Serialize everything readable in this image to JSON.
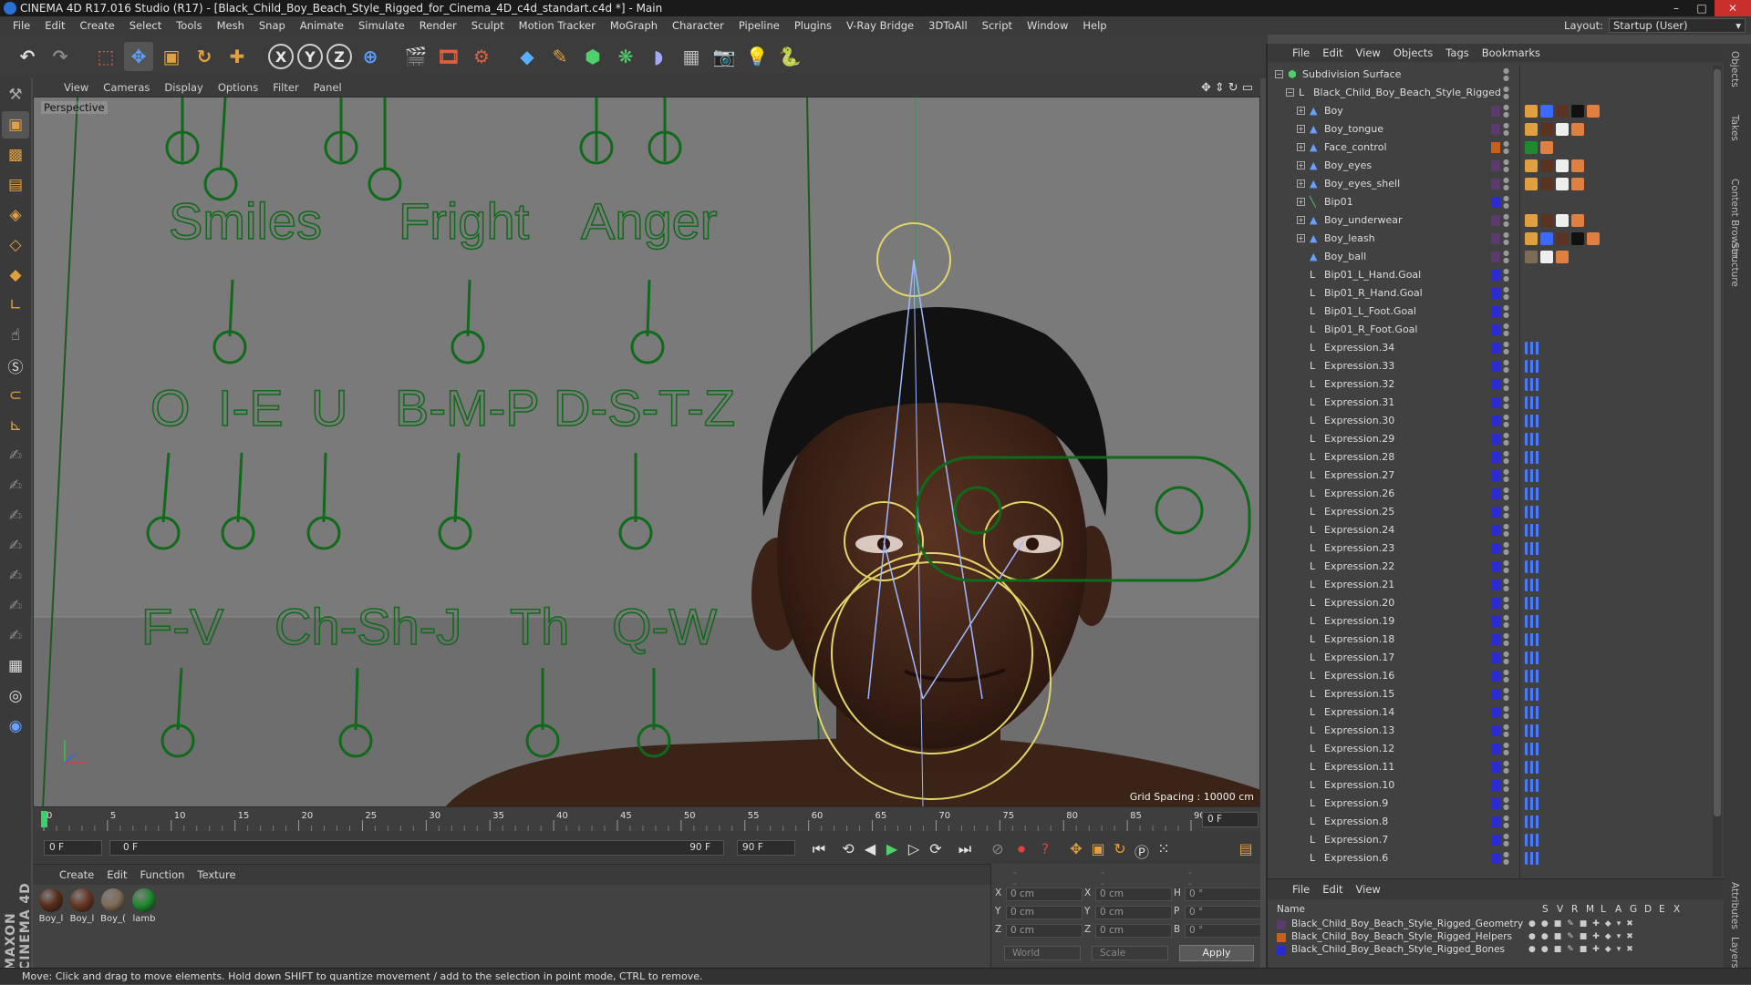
{
  "window": {
    "title": "CINEMA 4D R17.016 Studio (R17) - [Black_Child_Boy_Beach_Style_Rigged_for_Cinema_4D_c4d_standart.c4d *] - Main"
  },
  "menubar": {
    "items": [
      "File",
      "Edit",
      "Create",
      "Select",
      "Tools",
      "Mesh",
      "Snap",
      "Animate",
      "Simulate",
      "Render",
      "Sculpt",
      "Motion Tracker",
      "MoGraph",
      "Character",
      "Pipeline",
      "Plugins",
      "V-Ray Bridge",
      "3DToAll",
      "Script",
      "Window",
      "Help"
    ],
    "layout_label": "Layout:",
    "layout_value": "Startup (User)"
  },
  "toolbar": {
    "axis_x": "X",
    "axis_y": "Y",
    "axis_z": "Z"
  },
  "viewport": {
    "menu": [
      "View",
      "Cameras",
      "Display",
      "Options",
      "Filter",
      "Panel"
    ],
    "label": "Perspective",
    "grid_spacing": "Grid Spacing : 10000 cm",
    "face_labels": {
      "smiles": "Smiles",
      "fright": "Fright",
      "anger": "Anger",
      "o": "O",
      "ie": "I-E",
      "u": "U",
      "bmp": "B-M-P",
      "dstz": "D-S-T-Z",
      "fv": "F-V",
      "chshj": "Ch-Sh-J",
      "th": "Th",
      "qw": "Q-W"
    }
  },
  "timeline": {
    "ticks": [
      "0",
      "5",
      "10",
      "15",
      "20",
      "25",
      "30",
      "35",
      "40",
      "45",
      "50",
      "55",
      "60",
      "65",
      "70",
      "75",
      "80",
      "85",
      "90"
    ],
    "current_frame": "0 F"
  },
  "playbar": {
    "start_field": "0 F",
    "slider_start": "0 F",
    "slider_end": "90 F",
    "end_field": "90 F"
  },
  "material_panel": {
    "menu": [
      "Create",
      "Edit",
      "Function",
      "Texture"
    ],
    "materials": [
      {
        "label": "Boy_l",
        "color": "#5a2c1a"
      },
      {
        "label": "Boy_l",
        "color": "#6a3522"
      },
      {
        "label": "Boy_(",
        "color": "#7d6b55"
      },
      {
        "label": "lamb",
        "color": "#1e8a2e"
      }
    ]
  },
  "coordinates": {
    "x_pos": "0 cm",
    "y_pos": "0 cm",
    "z_pos": "0 cm",
    "x_size": "0 cm",
    "y_size": "0 cm",
    "z_size": "0 cm",
    "h": "0 °",
    "p": "0 °",
    "b": "0 °",
    "labels": {
      "x": "X",
      "y": "Y",
      "z": "Z",
      "x2": "X",
      "y2": "Y",
      "z2": "Z",
      "h": "H",
      "p": "P",
      "b": "B"
    },
    "dash1": "--",
    "dash2": "--",
    "dash3": "--",
    "mode_world": "World",
    "mode_scale": "Scale",
    "apply_label": "Apply"
  },
  "object_manager": {
    "menu": [
      "File",
      "Edit",
      "View",
      "Objects",
      "Tags",
      "Bookmarks"
    ],
    "objects": [
      {
        "name": "Subdivision Surface",
        "indent": 0,
        "icon": "subdiv-icon",
        "layer": "",
        "tagset": "none"
      },
      {
        "name": "Black_Child_Boy_Beach_Style_Rigged",
        "indent": 1,
        "icon": "null-icon",
        "layer": "",
        "tagset": "none"
      },
      {
        "name": "Boy",
        "indent": 2,
        "icon": "polygon-icon",
        "layer": "#5b3b6e",
        "tagset": "mesh"
      },
      {
        "name": "Boy_tongue",
        "indent": 2,
        "icon": "polygon-icon",
        "layer": "#5b3b6e",
        "tagset": "mesh2"
      },
      {
        "name": "Face_control",
        "indent": 2,
        "icon": "polygon-icon",
        "layer": "#c8601c",
        "tagset": "ctrl"
      },
      {
        "name": "Boy_eyes",
        "indent": 2,
        "icon": "polygon-icon",
        "layer": "#5b3b6e",
        "tagset": "mesh2"
      },
      {
        "name": "Boy_eyes_shell",
        "indent": 2,
        "icon": "polygon-icon",
        "layer": "#5b3b6e",
        "tagset": "mesh2"
      },
      {
        "name": "Bip01",
        "indent": 2,
        "icon": "bone-icon",
        "layer": "#2a2ad0",
        "tagset": "none"
      },
      {
        "name": "Boy_underwear",
        "indent": 2,
        "icon": "polygon-icon",
        "layer": "#5b3b6e",
        "tagset": "mesh2"
      },
      {
        "name": "Boy_leash",
        "indent": 2,
        "icon": "polygon-icon",
        "layer": "#5b3b6e",
        "tagset": "mesh"
      },
      {
        "name": "Boy_ball",
        "indent": 2,
        "icon": "polygon-icon",
        "layer": "#5b3b6e",
        "tagset": "ball"
      },
      {
        "name": "Bip01_L_Hand.Goal",
        "indent": 2,
        "icon": "null-icon",
        "layer": "#2a2ad0",
        "tagset": "none"
      },
      {
        "name": "Bip01_R_Hand.Goal",
        "indent": 2,
        "icon": "null-icon",
        "layer": "#2a2ad0",
        "tagset": "none"
      },
      {
        "name": "Bip01_L_Foot.Goal",
        "indent": 2,
        "icon": "null-icon",
        "layer": "#2a2ad0",
        "tagset": "none"
      },
      {
        "name": "Bip01_R_Foot.Goal",
        "indent": 2,
        "icon": "null-icon",
        "layer": "#2a2ad0",
        "tagset": "none"
      },
      {
        "name": "Expression.34",
        "indent": 2,
        "icon": "null-icon",
        "layer": "#2a2ad0",
        "tagset": "expr"
      },
      {
        "name": "Expression.33",
        "indent": 2,
        "icon": "null-icon",
        "layer": "#2a2ad0",
        "tagset": "expr"
      },
      {
        "name": "Expression.32",
        "indent": 2,
        "icon": "null-icon",
        "layer": "#2a2ad0",
        "tagset": "expr"
      },
      {
        "name": "Expression.31",
        "indent": 2,
        "icon": "null-icon",
        "layer": "#2a2ad0",
        "tagset": "expr"
      },
      {
        "name": "Expression.30",
        "indent": 2,
        "icon": "null-icon",
        "layer": "#2a2ad0",
        "tagset": "expr"
      },
      {
        "name": "Expression.29",
        "indent": 2,
        "icon": "null-icon",
        "layer": "#2a2ad0",
        "tagset": "expr"
      },
      {
        "name": "Expression.28",
        "indent": 2,
        "icon": "null-icon",
        "layer": "#2a2ad0",
        "tagset": "expr"
      },
      {
        "name": "Expression.27",
        "indent": 2,
        "icon": "null-icon",
        "layer": "#2a2ad0",
        "tagset": "expr"
      },
      {
        "name": "Expression.26",
        "indent": 2,
        "icon": "null-icon",
        "layer": "#2a2ad0",
        "tagset": "expr"
      },
      {
        "name": "Expression.25",
        "indent": 2,
        "icon": "null-icon",
        "layer": "#2a2ad0",
        "tagset": "expr"
      },
      {
        "name": "Expression.24",
        "indent": 2,
        "icon": "null-icon",
        "layer": "#2a2ad0",
        "tagset": "expr"
      },
      {
        "name": "Expression.23",
        "indent": 2,
        "icon": "null-icon",
        "layer": "#2a2ad0",
        "tagset": "expr"
      },
      {
        "name": "Expression.22",
        "indent": 2,
        "icon": "null-icon",
        "layer": "#2a2ad0",
        "tagset": "expr"
      },
      {
        "name": "Expression.21",
        "indent": 2,
        "icon": "null-icon",
        "layer": "#2a2ad0",
        "tagset": "expr"
      },
      {
        "name": "Expression.20",
        "indent": 2,
        "icon": "null-icon",
        "layer": "#2a2ad0",
        "tagset": "expr"
      },
      {
        "name": "Expression.19",
        "indent": 2,
        "icon": "null-icon",
        "layer": "#2a2ad0",
        "tagset": "expr"
      },
      {
        "name": "Expression.18",
        "indent": 2,
        "icon": "null-icon",
        "layer": "#2a2ad0",
        "tagset": "expr"
      },
      {
        "name": "Expression.17",
        "indent": 2,
        "icon": "null-icon",
        "layer": "#2a2ad0",
        "tagset": "expr"
      },
      {
        "name": "Expression.16",
        "indent": 2,
        "icon": "null-icon",
        "layer": "#2a2ad0",
        "tagset": "expr"
      },
      {
        "name": "Expression.15",
        "indent": 2,
        "icon": "null-icon",
        "layer": "#2a2ad0",
        "tagset": "expr"
      },
      {
        "name": "Expression.14",
        "indent": 2,
        "icon": "null-icon",
        "layer": "#2a2ad0",
        "tagset": "expr"
      },
      {
        "name": "Expression.13",
        "indent": 2,
        "icon": "null-icon",
        "layer": "#2a2ad0",
        "tagset": "expr"
      },
      {
        "name": "Expression.12",
        "indent": 2,
        "icon": "null-icon",
        "layer": "#2a2ad0",
        "tagset": "expr"
      },
      {
        "name": "Expression.11",
        "indent": 2,
        "icon": "null-icon",
        "layer": "#2a2ad0",
        "tagset": "expr"
      },
      {
        "name": "Expression.10",
        "indent": 2,
        "icon": "null-icon",
        "layer": "#2a2ad0",
        "tagset": "expr"
      },
      {
        "name": "Expression.9",
        "indent": 2,
        "icon": "null-icon",
        "layer": "#2a2ad0",
        "tagset": "expr"
      },
      {
        "name": "Expression.8",
        "indent": 2,
        "icon": "null-icon",
        "layer": "#2a2ad0",
        "tagset": "expr"
      },
      {
        "name": "Expression.7",
        "indent": 2,
        "icon": "null-icon",
        "layer": "#2a2ad0",
        "tagset": "expr"
      },
      {
        "name": "Expression.6",
        "indent": 2,
        "icon": "null-icon",
        "layer": "#2a2ad0",
        "tagset": "expr"
      }
    ]
  },
  "layer_manager": {
    "menu": [
      "File",
      "Edit",
      "View"
    ],
    "columns": {
      "name": "Name",
      "s": "S",
      "v": "V",
      "r": "R",
      "m": "M",
      "l": "L",
      "a": "A",
      "g": "G",
      "d": "D",
      "e": "E",
      "x": "X"
    },
    "layers": [
      {
        "name": "Black_Child_Boy_Beach_Style_Rigged_Geometry",
        "color": "#5b3b6e"
      },
      {
        "name": "Black_Child_Boy_Beach_Style_Rigged_Helpers",
        "color": "#c8601c"
      },
      {
        "name": "Black_Child_Boy_Beach_Style_Rigged_Bones",
        "color": "#2a2ad0"
      }
    ]
  },
  "side_tabs": [
    "Objects",
    "Takes",
    "Content Browser",
    "Structure"
  ],
  "side_tabs_lower": [
    "Attributes",
    "Layers"
  ],
  "status": {
    "text": "Move: Click and drag to move elements. Hold down SHIFT to quantize movement / add to the selection in point mode, CTRL to remove."
  },
  "colors": {
    "control_green": "#0f6a1a",
    "skin": "#3a2116",
    "rig_yellow": "#e2d56a",
    "rig_blue": "#9fb8ff",
    "accent_orange": "#e0a040"
  }
}
